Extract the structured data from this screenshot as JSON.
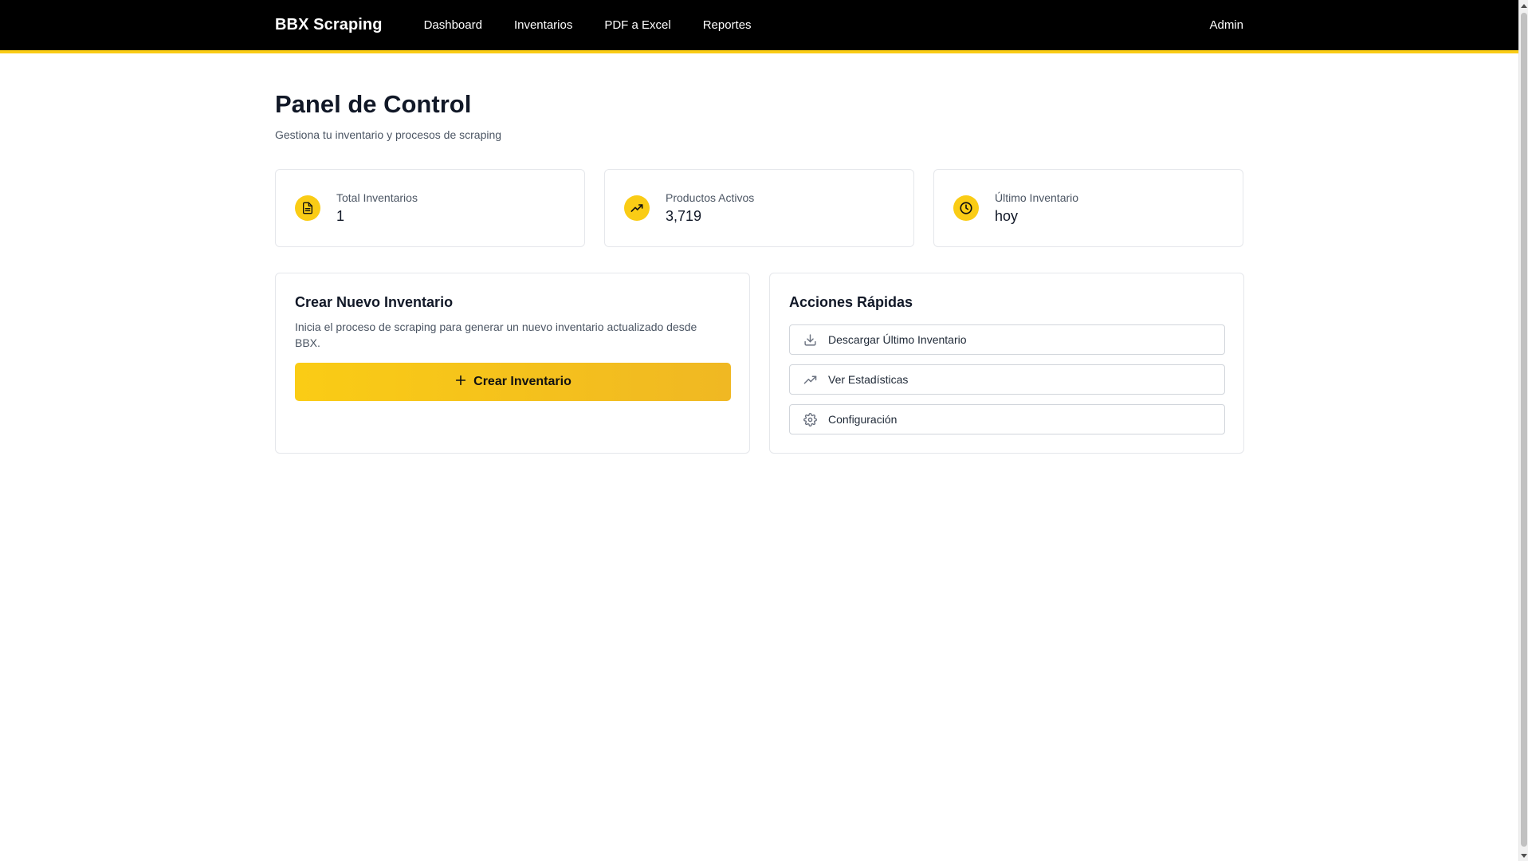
{
  "nav": {
    "brand": "BBX Scraping",
    "links": [
      "Dashboard",
      "Inventarios",
      "PDF a Excel",
      "Reportes"
    ],
    "user": "Admin"
  },
  "header": {
    "title": "Panel de Control",
    "subtitle": "Gestiona tu inventario y procesos de scraping"
  },
  "stats": [
    {
      "label": "Total Inventarios",
      "value": "1",
      "icon": "document-icon"
    },
    {
      "label": "Productos Activos",
      "value": "3,719",
      "icon": "trending-up-icon"
    },
    {
      "label": "Último Inventario",
      "value": "hoy",
      "icon": "clock-icon"
    }
  ],
  "create_panel": {
    "title": "Crear Nuevo Inventario",
    "description": "Inicia el proceso de scraping para generar un nuevo inventario actualizado desde BBX.",
    "button_label": "Crear Inventario",
    "button_icon": "plus-icon"
  },
  "quick_actions": {
    "title": "Acciones Rápidas",
    "items": [
      {
        "label": "Descargar Último Inventario",
        "icon": "download-icon"
      },
      {
        "label": "Ver Estadísticas",
        "icon": "trending-up-icon"
      },
      {
        "label": "Configuración",
        "icon": "gear-icon"
      }
    ]
  },
  "colors": {
    "accent": "#facc15",
    "nav_bg": "#000000",
    "text": "#111827",
    "muted": "#4b5563",
    "border": "#e5e7eb"
  }
}
